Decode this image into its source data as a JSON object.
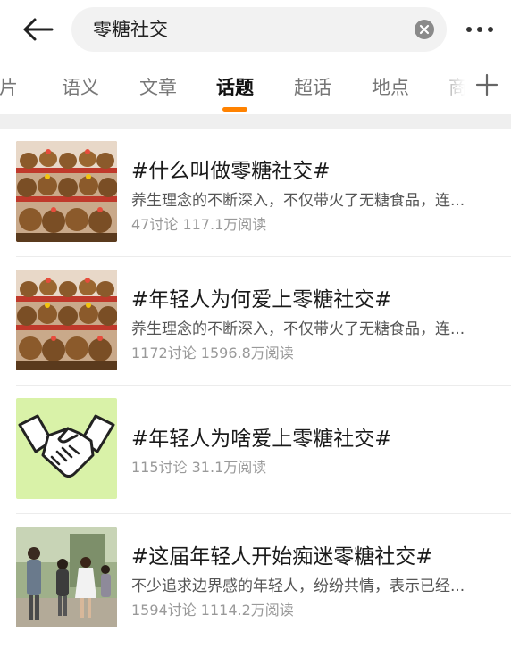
{
  "search": {
    "query": "零糖社交"
  },
  "tabs": [
    {
      "label": "图片"
    },
    {
      "label": "语义"
    },
    {
      "label": "文章"
    },
    {
      "label": "话题"
    },
    {
      "label": "超话"
    },
    {
      "label": "地点"
    },
    {
      "label": "商"
    }
  ],
  "active_tab": "话题",
  "colors": {
    "accent": "#ff8200",
    "title": "#1a1a1a",
    "desc": "#555555",
    "meta": "#999999"
  },
  "topics": [
    {
      "title": "#什么叫做零糖社交#",
      "desc": "养生理念的不断深入，不仅带火了无糖食品，连...",
      "meta": "47讨论 117.1万阅读",
      "thumb_icon": "capybara-plush-display-image"
    },
    {
      "title": "#年轻人为何爱上零糖社交#",
      "desc": "养生理念的不断深入，不仅带火了无糖食品，连...",
      "meta": "1172讨论 1596.8万阅读",
      "thumb_icon": "capybara-plush-display-image"
    },
    {
      "title": "#年轻人为啥爱上零糖社交#",
      "desc": "",
      "meta": "115讨论 31.1万阅读",
      "thumb_icon": "handshake-icon"
    },
    {
      "title": "#这届年轻人开始痴迷零糖社交#",
      "desc": "不少追求边界感的年轻人，纷纷共情，表示已经...",
      "meta": "1594讨论 1114.2万阅读",
      "thumb_icon": "people-photo-image"
    }
  ]
}
